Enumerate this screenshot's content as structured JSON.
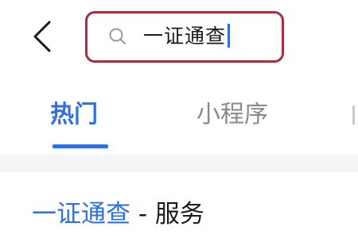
{
  "header": {
    "back_icon": "chevron-left-icon",
    "search": {
      "icon": "search-icon",
      "value": "一证通查"
    }
  },
  "tabs": [
    {
      "label": "热门",
      "active": true
    },
    {
      "label": "小程序",
      "active": false
    }
  ],
  "results": [
    {
      "highlight": "一证通查",
      "suffix": " - 服务"
    }
  ],
  "colors": {
    "accent": "#2f6fe0",
    "highlight_border": "#a4303f",
    "inactive_tab": "#8a8a8a",
    "section_band": "#f4f5f7"
  }
}
